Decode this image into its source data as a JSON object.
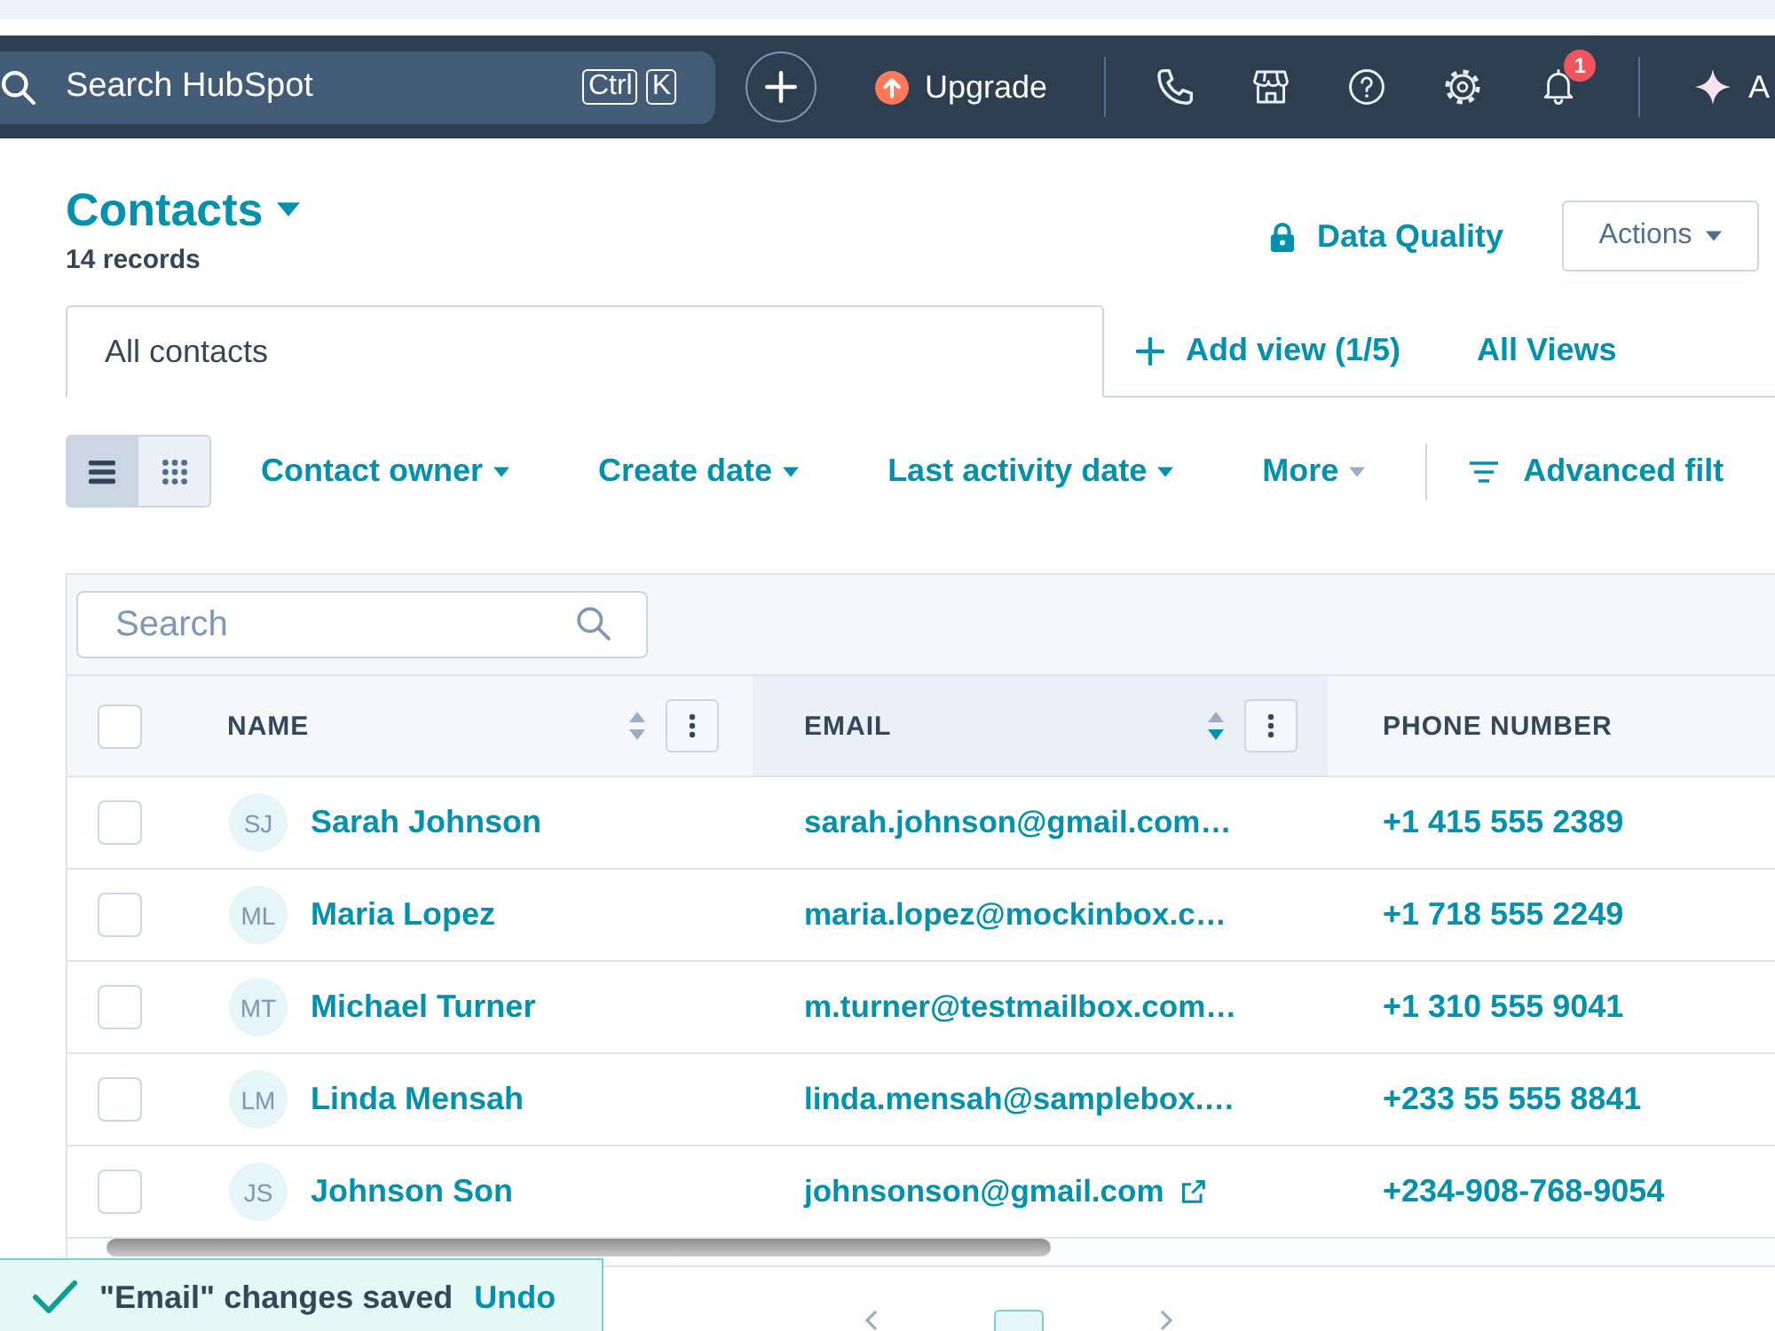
{
  "top_nav": {
    "search": {
      "placeholder": "Search HubSpot",
      "shortcut_keys": [
        "Ctrl",
        "K"
      ]
    },
    "upgrade_label": "Upgrade",
    "icons": [
      {
        "kind": "phone"
      },
      {
        "kind": "store"
      },
      {
        "kind": "help"
      },
      {
        "kind": "settings"
      },
      {
        "kind": "bell",
        "badge": "1"
      }
    ],
    "assistant_label": "A"
  },
  "page_header": {
    "title": "Contacts",
    "record_count": "14 records",
    "data_quality_label": "Data Quality",
    "actions_label": "Actions"
  },
  "view_tabs": {
    "tabs": [
      {
        "label": "All contacts",
        "selected": true
      }
    ],
    "add_view_label": "Add view (1/5)",
    "all_views_label": "All Views"
  },
  "filter_bar": {
    "view_modes": [
      {
        "kind": "list",
        "selected": true
      },
      {
        "kind": "grid",
        "selected": false
      }
    ],
    "filters": [
      {
        "label": "Contact owner",
        "kind": "primary"
      },
      {
        "label": "Create date",
        "kind": "primary"
      },
      {
        "label": "Last activity date",
        "kind": "primary"
      },
      {
        "label": "More",
        "kind": "secondary"
      }
    ],
    "advanced_filters_label": "Advanced filt"
  },
  "table": {
    "search": {
      "placeholder": "Search"
    },
    "select_all": {
      "checked": false
    },
    "columns": [
      {
        "label": "NAME",
        "sortable": true,
        "sorted": false,
        "menu": true
      },
      {
        "label": "EMAIL",
        "sortable": true,
        "sorted": true,
        "menu": true
      },
      {
        "label": "PHONE NUMBER",
        "sortable": false,
        "sorted": false,
        "menu": false
      }
    ],
    "rows": [
      {
        "initials": "SJ",
        "name": "Sarah Johnson",
        "email": "sarah.johnson@gmail.com…",
        "phone": "+1 415 555 2389",
        "checked": false,
        "external_link": false
      },
      {
        "initials": "ML",
        "name": "Maria Lopez",
        "email": "maria.lopez@mockinbox.c…",
        "phone": "+1 718 555 2249",
        "checked": false,
        "external_link": false
      },
      {
        "initials": "MT",
        "name": "Michael Turner",
        "email": "m.turner@testmailbox.com…",
        "phone": "+1 310 555 9041",
        "checked": false,
        "external_link": false
      },
      {
        "initials": "LM",
        "name": "Linda Mensah",
        "email": "linda.mensah@samplebox.…",
        "phone": "+233 55 555 8841",
        "checked": false,
        "external_link": false
      },
      {
        "initials": "JS",
        "name": "Johnson Son",
        "email": "johnsonson@gmail.com",
        "phone": "+234-908-768-9054",
        "checked": false,
        "external_link": true
      }
    ]
  },
  "pagination": {
    "pages": [
      {
        "selected": true
      }
    ]
  },
  "toast": {
    "message": "\"Email\" changes saved",
    "action_label": "Undo"
  }
}
